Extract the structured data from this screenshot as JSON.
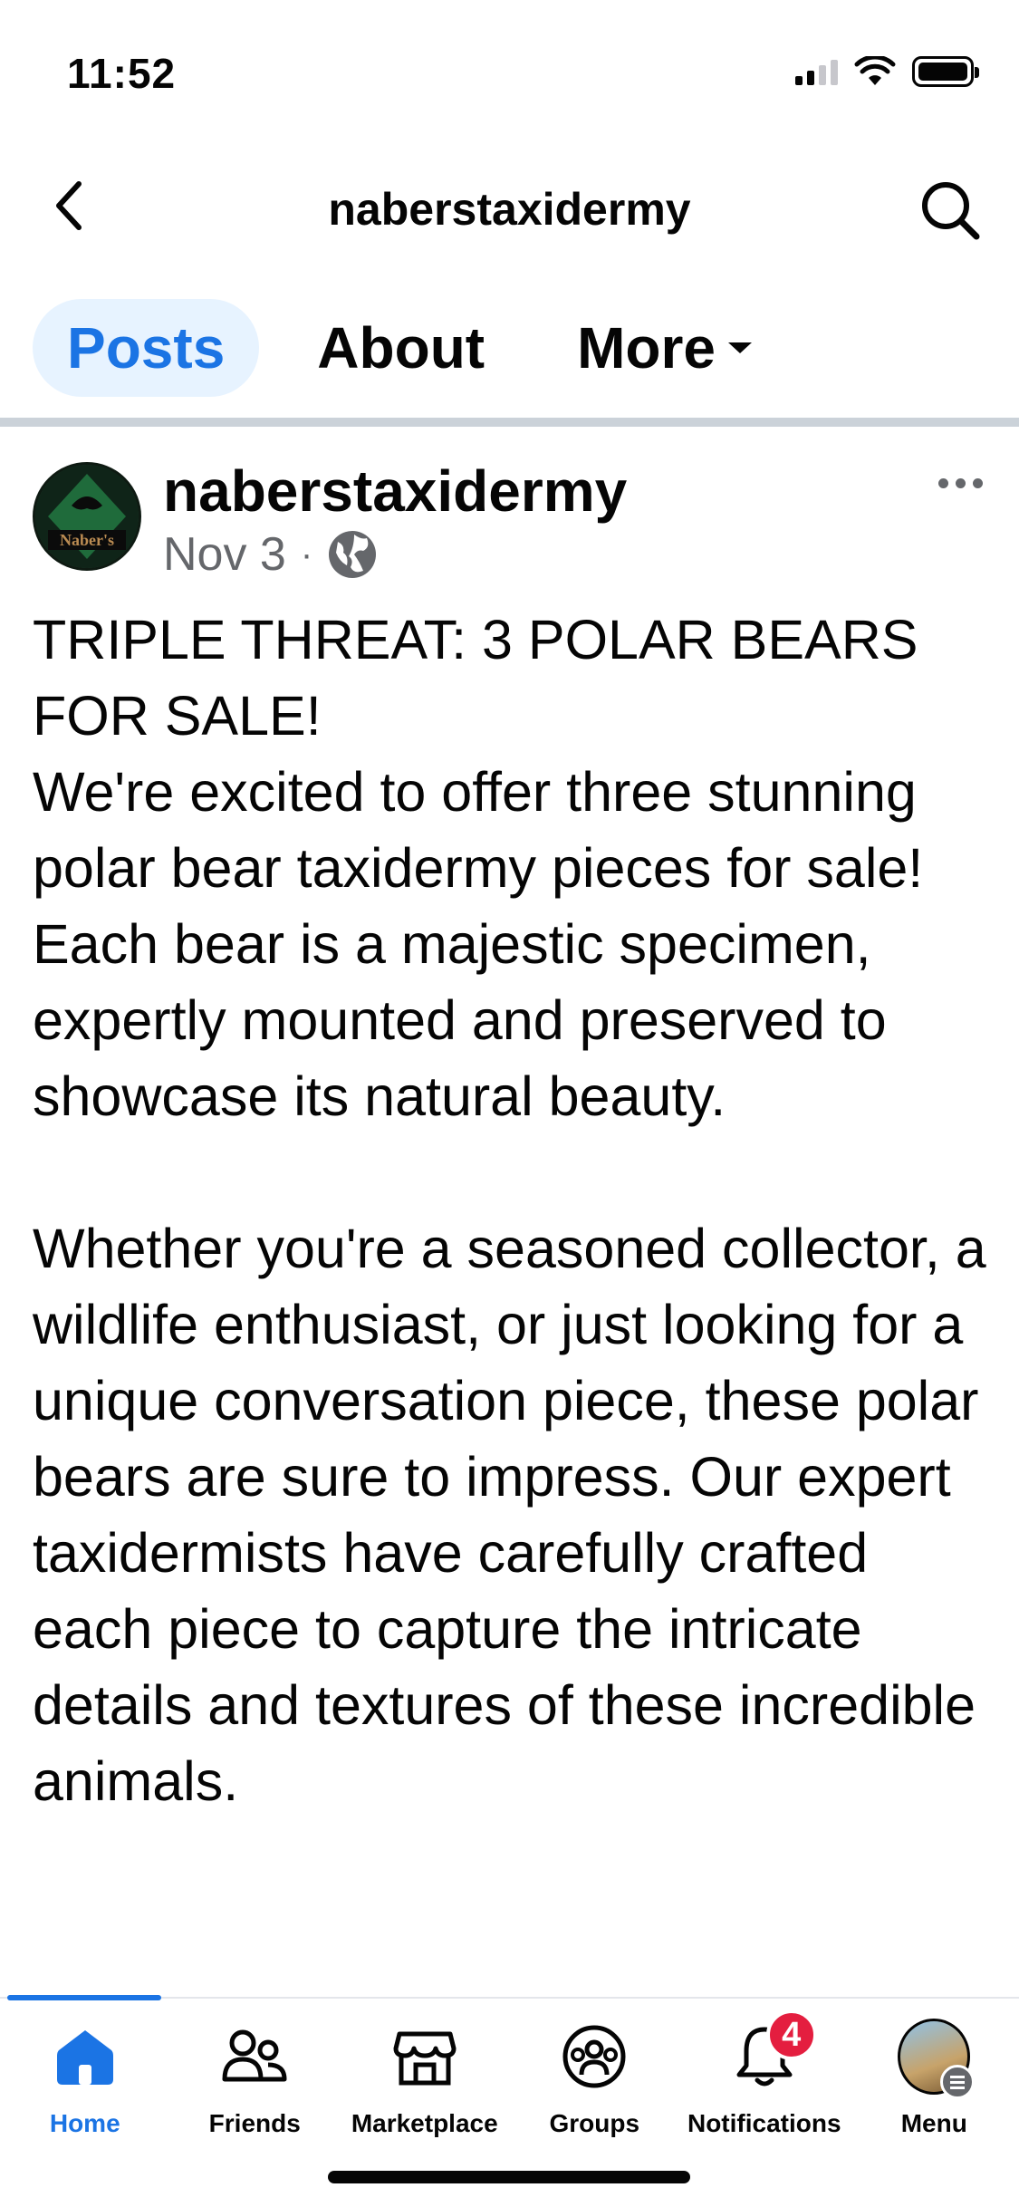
{
  "status_bar": {
    "time": "11:52"
  },
  "header": {
    "title": "naberstaxidermy"
  },
  "tabs": [
    {
      "label": "Posts"
    },
    {
      "label": "About"
    },
    {
      "label": "More"
    }
  ],
  "post": {
    "author": "naberstaxidermy",
    "avatar_text": "Naber's",
    "date": "Nov 3",
    "separator": "·",
    "body": "TRIPLE THREAT: 3 POLAR BEARS FOR SALE!\nWe're excited to offer three stunning polar bear taxidermy pieces for sale! Each bear is a majestic specimen, expertly mounted and preserved to showcase its natural beauty.\n\nWhether you're a seasoned collector, a wildlife enthusiast, or just looking for a unique conversation piece, these polar bears are sure to impress. Our expert taxidermists have carefully crafted each piece to capture the intricate details and textures of these incredible animals."
  },
  "bottom_nav": {
    "items": [
      {
        "label": "Home",
        "icon": "home-icon"
      },
      {
        "label": "Friends",
        "icon": "friends-icon"
      },
      {
        "label": "Marketplace",
        "icon": "marketplace-icon"
      },
      {
        "label": "Groups",
        "icon": "groups-icon"
      },
      {
        "label": "Notifications",
        "icon": "bell-icon",
        "badge": "4"
      },
      {
        "label": "Menu",
        "icon": "menu-icon"
      }
    ]
  },
  "colors": {
    "accent": "#1b74e4",
    "tab_active_bg": "#e7f3ff",
    "badge": "#e41e3f",
    "meta_gray": "#65676b"
  }
}
